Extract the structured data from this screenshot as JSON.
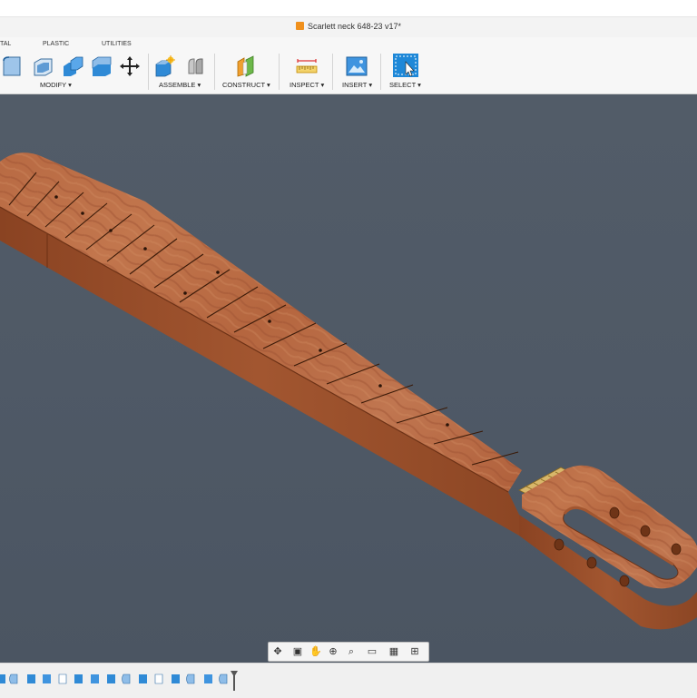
{
  "window": {
    "title": "Scarlett neck 648-23 v17*"
  },
  "tabs": [
    "TAL",
    "PLASTIC",
    "UTILITIES"
  ],
  "toolbar_groups": {
    "modify": "MODIFY ▾",
    "assemble": "ASSEMBLE ▾",
    "construct": "CONSTRUCT ▾",
    "inspect": "INSPECT ▾",
    "insert": "INSERT ▾",
    "select": "SELECT ▾"
  },
  "colors": {
    "viewport_bg": "#505a67",
    "wood": "#b8623c",
    "accent_select": "#1e88d8",
    "icon_blue": "#2f8ad6"
  },
  "nav_icons": [
    "orbit-icon",
    "look-at-icon",
    "pan-icon",
    "zoom-window-icon",
    "zoom-icon",
    "display-settings-icon",
    "grid-settings-icon",
    "viewports-icon"
  ],
  "timeline_items": [
    "sketch",
    "body",
    "body",
    "body",
    "sketch",
    "body",
    "body",
    "sketch",
    "body",
    "body",
    "sketch",
    "body",
    "body",
    "sketch",
    "body",
    "body",
    "sketch",
    "body",
    "sketch",
    "body",
    "marker"
  ]
}
